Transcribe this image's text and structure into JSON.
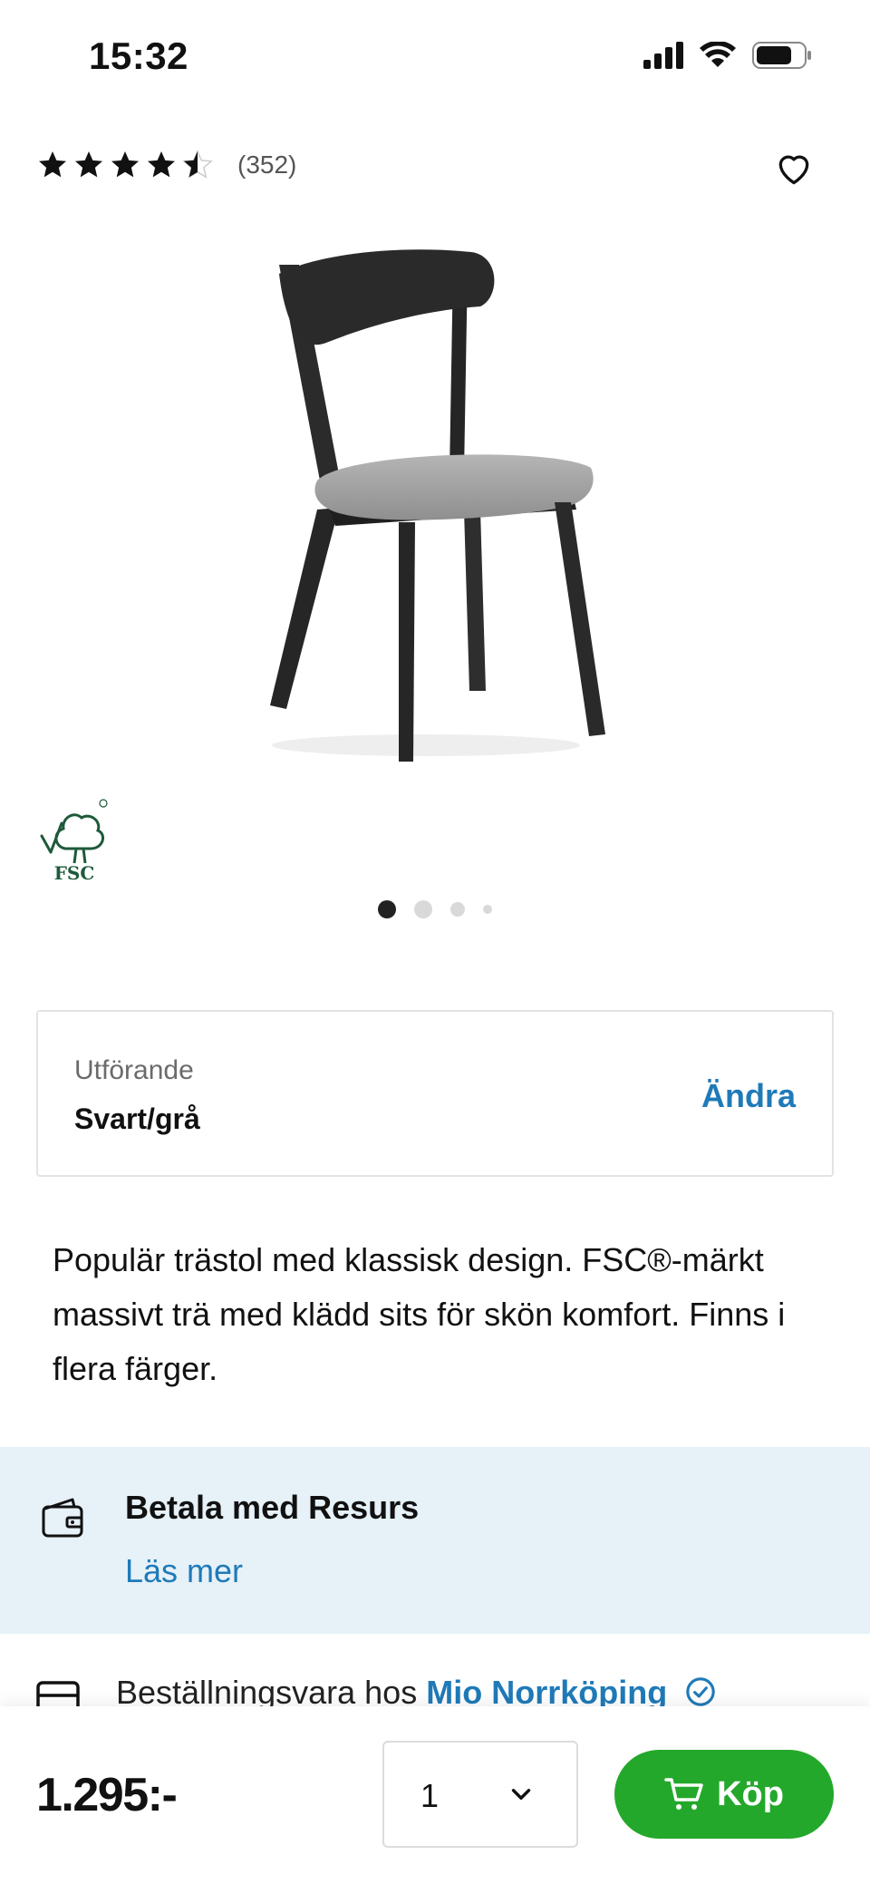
{
  "status_bar": {
    "time": "15:32",
    "icons": [
      "signal-icon",
      "wifi-icon",
      "battery-icon"
    ]
  },
  "rating": {
    "stars": 4.5,
    "max_stars": 5,
    "count_label": "(352)"
  },
  "product": {
    "image": "chair-image",
    "certification_logo": "FSC"
  },
  "carousel": {
    "slide_count": 4,
    "active_index": 0
  },
  "variant": {
    "label": "Utförande",
    "value": "Svart/grå",
    "change_label": "Ändra"
  },
  "description": "Populär trästol med klassisk design. FSC®-märkt massivt trä med klädd sits för skön komfort. Finns i flera färger.",
  "payment": {
    "title": "Betala med Resurs",
    "link_label": "Läs mer"
  },
  "availability": {
    "text": "Beställningsvara hos",
    "store": "Mio Norrköping"
  },
  "purchase": {
    "price": "1.295:-",
    "quantity": "1",
    "buy_label": "Köp"
  },
  "colors": {
    "accent_blue": "#1f7ab8",
    "buy_green": "#24a82b",
    "band_blue": "#e6f1f8",
    "fsc_green": "#1e5a3a"
  }
}
